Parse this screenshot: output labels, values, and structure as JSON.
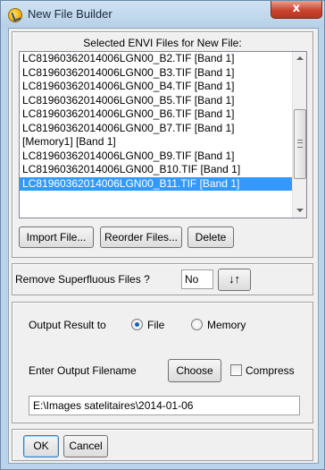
{
  "window": {
    "title": "New File Builder",
    "close_glyph": "x"
  },
  "files": {
    "caption": "Selected ENVI Files for New File:",
    "items": [
      "LC81960362014006LGN00_B2.TIF [Band 1]",
      "LC81960362014006LGN00_B3.TIF [Band 1]",
      "LC81960362014006LGN00_B4.TIF [Band 1]",
      "LC81960362014006LGN00_B5.TIF [Band 1]",
      "LC81960362014006LGN00_B6.TIF [Band 1]",
      "LC81960362014006LGN00_B7.TIF [Band 1]",
      "[Memory1] [Band 1]",
      "LC81960362014006LGN00_B9.TIF [Band 1]",
      "LC81960362014006LGN00_B10.TIF [Band 1]",
      "LC81960362014006LGN00_B11.TIF [Band 1]"
    ],
    "selected_index": 9,
    "import_label": "Import File...",
    "reorder_label": "Reorder Files...",
    "delete_label": "Delete"
  },
  "remove": {
    "label": "Remove Superfluous Files ?",
    "value": "No",
    "sort_glyph": "↓↑"
  },
  "output": {
    "label": "Output Result to",
    "option_file": "File",
    "option_memory": "Memory",
    "selected": "File",
    "filename_label": "Enter Output Filename",
    "choose_label": "Choose",
    "compress_label": "Compress",
    "compress_checked": false,
    "path": "E:\\Images satelitaires\\2014-01-06"
  },
  "actions": {
    "ok_label": "OK",
    "cancel_label": "Cancel"
  },
  "colors": {
    "selection": "#3399ff",
    "title_bar": "#b8d3ea",
    "close_button": "#c9452f"
  }
}
